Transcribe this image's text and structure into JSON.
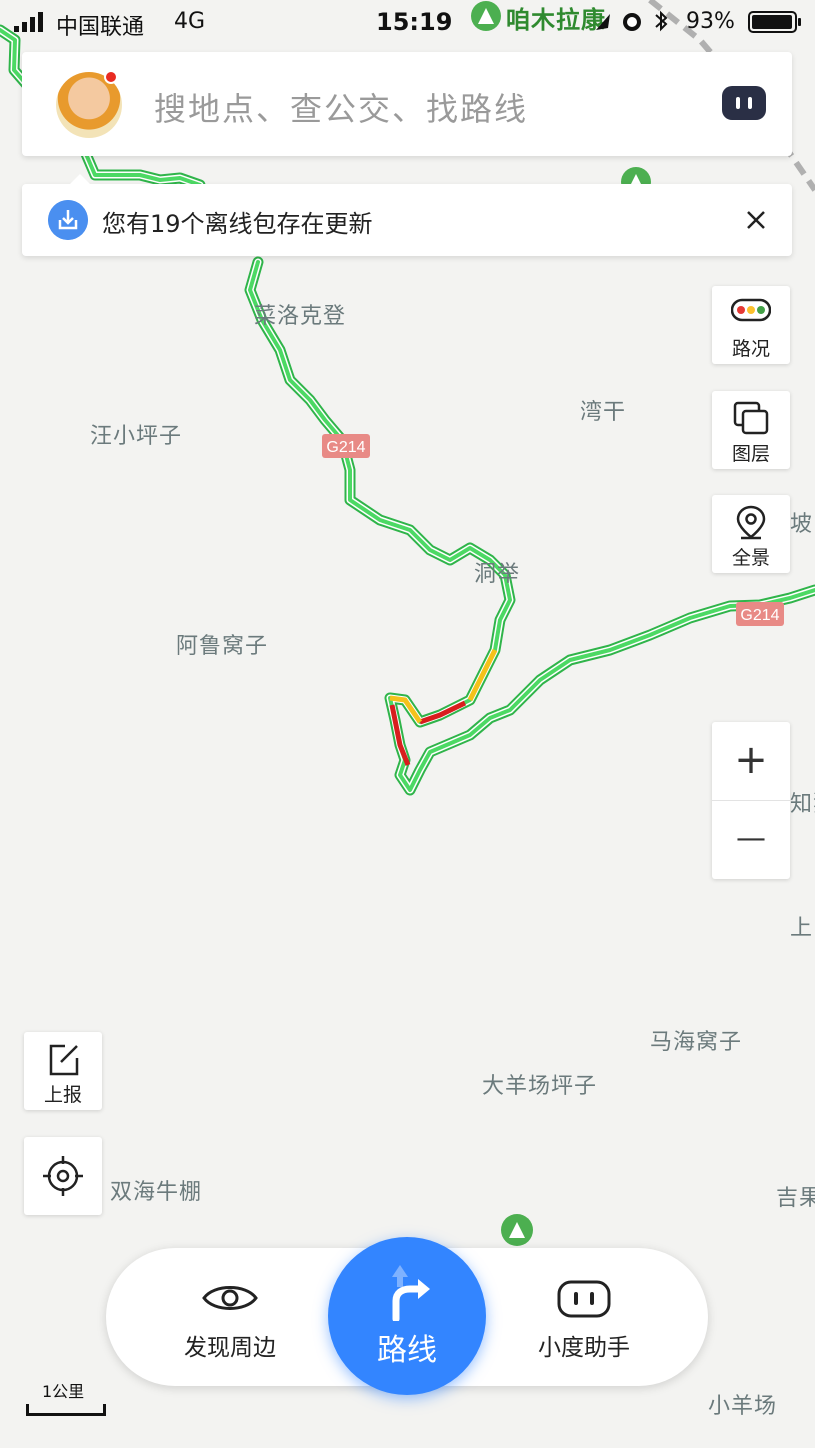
{
  "status_bar": {
    "carrier": "中国联通",
    "network": "4G",
    "time": "15:19",
    "battery_percent": "93%"
  },
  "search": {
    "placeholder": "搜地点、查公交、找路线",
    "avatar_icon": "user-avatar",
    "assistant_icon": "duer-robot-icon"
  },
  "banner": {
    "text": "您有19个离线包存在更新",
    "icon": "download-icon",
    "close_icon": "close-icon"
  },
  "controls": {
    "traffic": "路况",
    "layers": "图层",
    "panorama": "全景",
    "zoom_in": "+",
    "zoom_out": "—",
    "report": "上报",
    "locate_icon": "locate-icon"
  },
  "bottom_bar": {
    "discover": "发现周边",
    "route": "路线",
    "assistant": "小度助手"
  },
  "scale": "1公里",
  "map": {
    "places": [
      {
        "key": "zmlk",
        "name": "咱木拉康",
        "type": "poi"
      },
      {
        "key": "clkd",
        "name": "菜洛克登"
      },
      {
        "key": "wxpz",
        "name": "汪小坪子"
      },
      {
        "key": "wg",
        "name": "湾干"
      },
      {
        "key": "dj",
        "name": "洞举"
      },
      {
        "key": "alwz",
        "name": "阿鲁窝子"
      },
      {
        "key": "po",
        "name": "坡"
      },
      {
        "key": "zhigou",
        "name": "知狗"
      },
      {
        "key": "shang",
        "name": "上"
      },
      {
        "key": "mhwz",
        "name": "马海窝子"
      },
      {
        "key": "dycpz",
        "name": "大羊场坪子"
      },
      {
        "key": "shnp",
        "name": "双海牛棚"
      },
      {
        "key": "ji",
        "name": "吉果"
      },
      {
        "key": "xyc",
        "name": "小羊场"
      }
    ],
    "road_shields": [
      "G214",
      "G214"
    ],
    "traffic_colors": {
      "smooth": "#4cd964",
      "slow": "#f5c21b",
      "jam": "#d81e1e"
    }
  }
}
